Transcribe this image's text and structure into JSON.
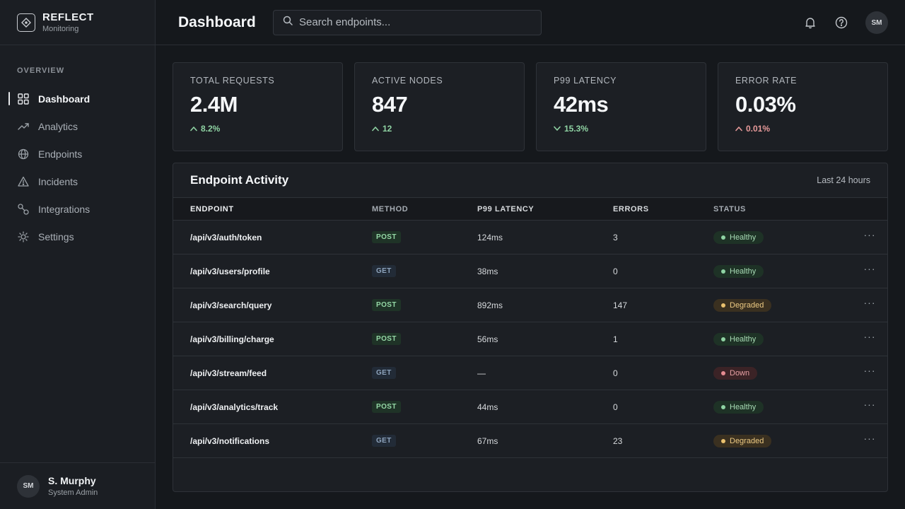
{
  "brand": {
    "name": "REFLECT",
    "subtitle": "Monitoring"
  },
  "sidebar": {
    "section": "OVERVIEW",
    "items": [
      {
        "label": "Dashboard",
        "icon": "grid-icon",
        "active": true
      },
      {
        "label": "Analytics",
        "icon": "trend-icon"
      },
      {
        "label": "Endpoints",
        "icon": "globe-icon"
      },
      {
        "label": "Incidents",
        "icon": "warning-icon"
      },
      {
        "label": "Integrations",
        "icon": "link-icon"
      },
      {
        "label": "Settings",
        "icon": "gear-icon"
      }
    ]
  },
  "user": {
    "initials": "SM",
    "name": "S. Murphy",
    "role": "System Admin"
  },
  "header": {
    "title": "Dashboard",
    "search_placeholder": "Search endpoints...",
    "avatar_initials": "SM"
  },
  "stats": [
    {
      "label": "TOTAL REQUESTS",
      "value": "2.4M",
      "delta": "8.2%",
      "direction": "up",
      "tone": "good"
    },
    {
      "label": "ACTIVE NODES",
      "value": "847",
      "delta": "12",
      "direction": "up",
      "tone": "good"
    },
    {
      "label": "P99 LATENCY",
      "value": "42ms",
      "delta": "15.3%",
      "direction": "down",
      "tone": "good"
    },
    {
      "label": "ERROR RATE",
      "value": "0.03%",
      "delta": "0.01%",
      "direction": "up",
      "tone": "bad"
    }
  ],
  "table": {
    "title": "Endpoint Activity",
    "range": "Last 24 hours",
    "columns": [
      "ENDPOINT",
      "METHOD",
      "P99 LATENCY",
      "ERRORS",
      "STATUS"
    ],
    "rows": [
      {
        "endpoint": "/api/v3/auth/token",
        "method": "POST",
        "latency": "124ms",
        "errors": "3",
        "status": "Healthy"
      },
      {
        "endpoint": "/api/v3/users/profile",
        "method": "GET",
        "latency": "38ms",
        "errors": "0",
        "status": "Healthy"
      },
      {
        "endpoint": "/api/v3/search/query",
        "method": "POST",
        "latency": "892ms",
        "errors": "147",
        "status": "Degraded"
      },
      {
        "endpoint": "/api/v3/billing/charge",
        "method": "POST",
        "latency": "56ms",
        "errors": "1",
        "status": "Healthy"
      },
      {
        "endpoint": "/api/v3/stream/feed",
        "method": "GET",
        "latency": "—",
        "errors": "0",
        "status": "Down"
      },
      {
        "endpoint": "/api/v3/analytics/track",
        "method": "POST",
        "latency": "44ms",
        "errors": "0",
        "status": "Healthy"
      },
      {
        "endpoint": "/api/v3/notifications",
        "method": "GET",
        "latency": "67ms",
        "errors": "23",
        "status": "Degraded"
      }
    ],
    "more_glyph": "···"
  },
  "colors": {
    "background": "#15181c",
    "surface": "#1c1f24",
    "border": "#2e3238",
    "healthy": "#8fd3a3",
    "degraded": "#e9c06e",
    "down": "#e58b91"
  }
}
